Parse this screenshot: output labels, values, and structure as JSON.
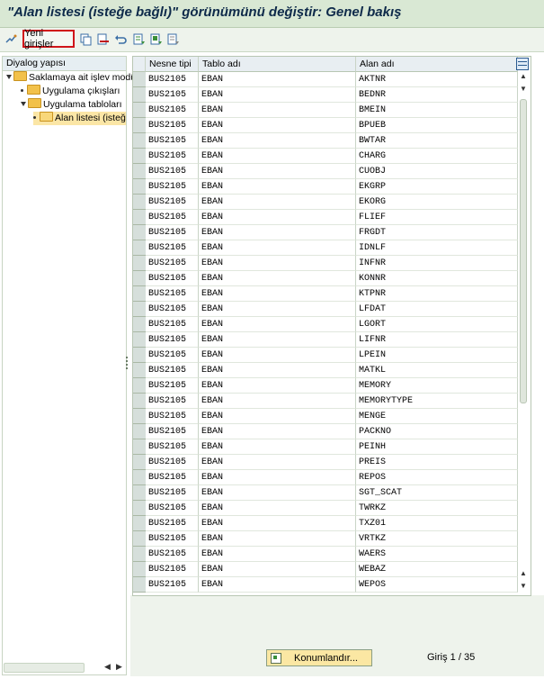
{
  "window": {
    "title": "\"Alan listesi (isteğe bağlı)\" görünümünü değiştir: Genel bakış"
  },
  "toolbar": {
    "new_entries_label": "Yeni girişler",
    "icons": [
      "display-change-icon",
      "copy-icon",
      "delete-icon",
      "undo-icon",
      "select-all-icon",
      "select-block-icon",
      "deselect-all-icon"
    ]
  },
  "dialog_structure": {
    "header": "Diyalog yapısı",
    "items": [
      {
        "label": "Saklamaya ait işlev modü"
      },
      {
        "label": "Uygulama çıkışları"
      },
      {
        "label": "Uygulama tabloları"
      },
      {
        "label": "Alan listesi (isteğe"
      }
    ]
  },
  "grid": {
    "columns": [
      "Nesne tipi",
      "Tablo adı",
      "Alan adı"
    ],
    "rows": [
      [
        "BUS2105",
        "EBAN",
        "AKTNR"
      ],
      [
        "BUS2105",
        "EBAN",
        "BEDNR"
      ],
      [
        "BUS2105",
        "EBAN",
        "BMEIN"
      ],
      [
        "BUS2105",
        "EBAN",
        "BPUEB"
      ],
      [
        "BUS2105",
        "EBAN",
        "BWTAR"
      ],
      [
        "BUS2105",
        "EBAN",
        "CHARG"
      ],
      [
        "BUS2105",
        "EBAN",
        "CUOBJ"
      ],
      [
        "BUS2105",
        "EBAN",
        "EKGRP"
      ],
      [
        "BUS2105",
        "EBAN",
        "EKORG"
      ],
      [
        "BUS2105",
        "EBAN",
        "FLIEF"
      ],
      [
        "BUS2105",
        "EBAN",
        "FRGDT"
      ],
      [
        "BUS2105",
        "EBAN",
        "IDNLF"
      ],
      [
        "BUS2105",
        "EBAN",
        "INFNR"
      ],
      [
        "BUS2105",
        "EBAN",
        "KONNR"
      ],
      [
        "BUS2105",
        "EBAN",
        "KTPNR"
      ],
      [
        "BUS2105",
        "EBAN",
        "LFDAT"
      ],
      [
        "BUS2105",
        "EBAN",
        "LGORT"
      ],
      [
        "BUS2105",
        "EBAN",
        "LIFNR"
      ],
      [
        "BUS2105",
        "EBAN",
        "LPEIN"
      ],
      [
        "BUS2105",
        "EBAN",
        "MATKL"
      ],
      [
        "BUS2105",
        "EBAN",
        "MEMORY"
      ],
      [
        "BUS2105",
        "EBAN",
        "MEMORYTYPE"
      ],
      [
        "BUS2105",
        "EBAN",
        "MENGE"
      ],
      [
        "BUS2105",
        "EBAN",
        "PACKNO"
      ],
      [
        "BUS2105",
        "EBAN",
        "PEINH"
      ],
      [
        "BUS2105",
        "EBAN",
        "PREIS"
      ],
      [
        "BUS2105",
        "EBAN",
        "REPOS"
      ],
      [
        "BUS2105",
        "EBAN",
        "SGT_SCAT"
      ],
      [
        "BUS2105",
        "EBAN",
        "TWRKZ"
      ],
      [
        "BUS2105",
        "EBAN",
        "TXZ01"
      ],
      [
        "BUS2105",
        "EBAN",
        "VRTKZ"
      ],
      [
        "BUS2105",
        "EBAN",
        "WAERS"
      ],
      [
        "BUS2105",
        "EBAN",
        "WEBAZ"
      ],
      [
        "BUS2105",
        "EBAN",
        "WEPOS"
      ]
    ]
  },
  "footer": {
    "position_button_label": "Konumlandır...",
    "entry_info": "Giriş 1 / 35"
  }
}
